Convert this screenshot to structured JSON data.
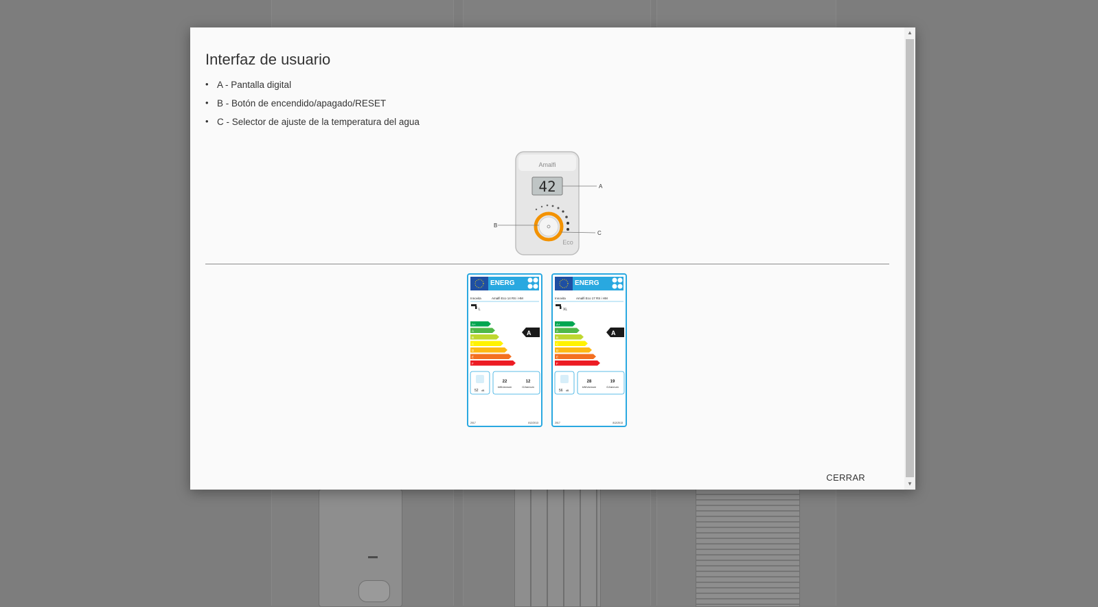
{
  "modal": {
    "title": "Interfaz de usuario",
    "features": [
      "A - Pantalla digital",
      "B - Botón de encendido/apagado/RESET",
      "C - Selector de ajuste de la temperatura del agua"
    ],
    "close_label": "CERRAR"
  },
  "device": {
    "brand": "Amalfi",
    "display_value": "42",
    "mode_label": "Eco",
    "callouts": {
      "a": "A",
      "b": "B",
      "c": "C"
    }
  },
  "energy_labels": [
    {
      "title": "ENERG",
      "supplier": "Innovita",
      "model": "Amalfi Eco 14 RS i HM",
      "load_profile": "L",
      "rating": "A",
      "scale": [
        "A+",
        "A",
        "B",
        "C",
        "D",
        "E",
        "F"
      ],
      "noise": "52",
      "noise_unit": "dB",
      "kwh": "22",
      "kwh_unit": "kWh/annum",
      "gj": "12",
      "gj_unit": "GJ/annum",
      "year": "2017",
      "regulation": "812/2013"
    },
    {
      "title": "ENERG",
      "supplier": "Innovita",
      "model": "Amalfi Eco 17 RS i HM",
      "load_profile": "XL",
      "rating": "A",
      "scale": [
        "A+",
        "A",
        "B",
        "C",
        "D",
        "E",
        "F"
      ],
      "noise": "56",
      "noise_unit": "dB",
      "kwh": "28",
      "kwh_unit": "kWh/annum",
      "gj": "19",
      "gj_unit": "GJ/annum",
      "year": "2017",
      "regulation": "812/2013"
    }
  ],
  "colors": {
    "overlay": "#7d7d7d",
    "modal_bg": "#fafafa",
    "label_border": "#29a8e0",
    "eu_blue": "#1e4fa3",
    "knob_orange": "#f39200"
  },
  "scale_colors": [
    "#00a651",
    "#50b848",
    "#bfd730",
    "#fff200",
    "#fdb913",
    "#f37021",
    "#ed1c24"
  ]
}
